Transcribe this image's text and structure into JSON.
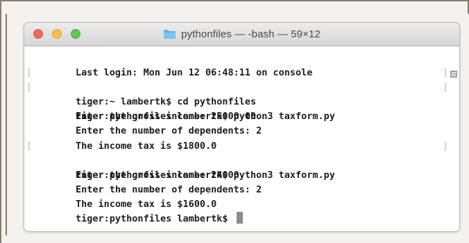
{
  "window": {
    "title": "pythonfiles — -bash — 59×12",
    "folder_icon": "folder-icon",
    "traffic_lights": {
      "close_color": "#ee6a5f",
      "minimize_color": "#f5bf4f",
      "zoom_color": "#61c454"
    }
  },
  "terminal": {
    "lines": [
      {
        "text": "Last login: Mon Jun 12 06:48:11 on console",
        "prompt": false
      },
      {
        "text": "tiger:~ lambertk$ cd pythonfiles",
        "prompt": true
      },
      {
        "text": "tiger:pythonfiles lambertk$ python3 taxform.py",
        "prompt": true
      },
      {
        "text": "Enter the gross income: 25000.00",
        "prompt": false
      },
      {
        "text": "Enter the number of dependents: 2",
        "prompt": false
      },
      {
        "text": "The income tax is $1800.0",
        "prompt": false
      },
      {
        "text": "tiger:pythonfiles lambertk$ python3 taxform.py",
        "prompt": true
      },
      {
        "text": "Enter the gross income: 24000",
        "prompt": false
      },
      {
        "text": "Enter the number of dependents: 2",
        "prompt": false
      },
      {
        "text": "The income tax is $1600.0",
        "prompt": false
      },
      {
        "text": "tiger:pythonfiles lambertk$ ",
        "prompt": false,
        "cursor": true
      }
    ]
  },
  "icons": {
    "scroll_indicator": "scrollbar-menu-icon"
  }
}
